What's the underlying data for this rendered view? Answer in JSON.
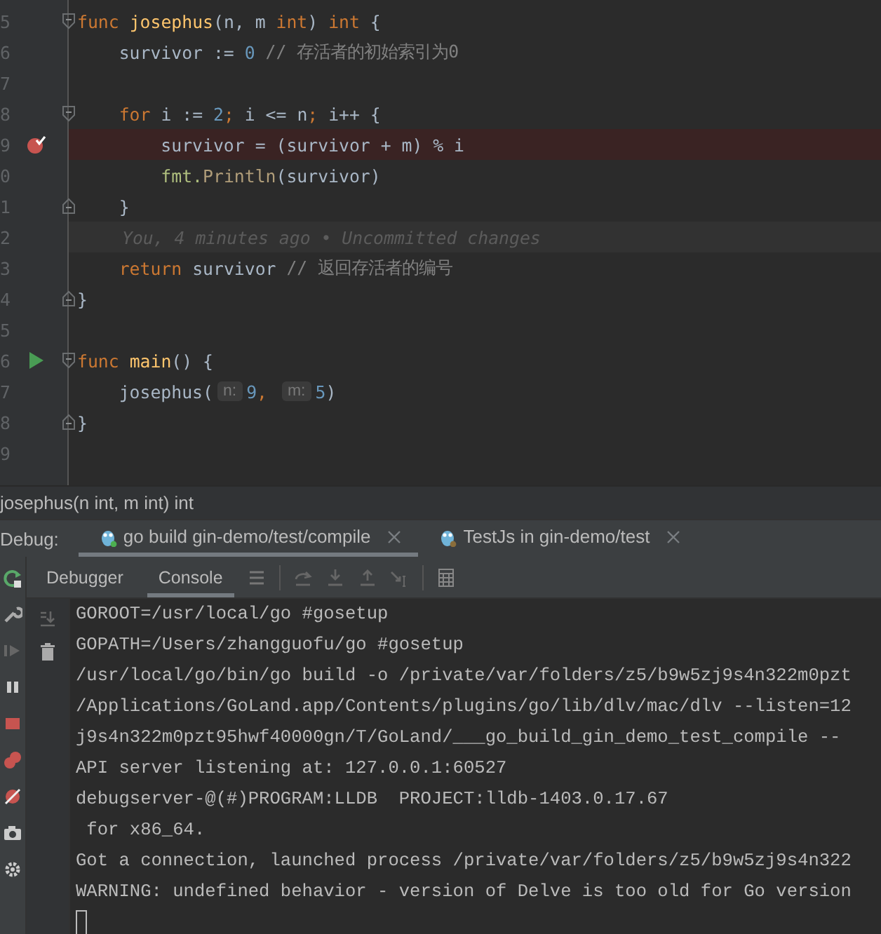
{
  "editor": {
    "lines": [
      {
        "number": "5",
        "fold_start": true,
        "tokens": [
          {
            "kind": "keyword",
            "text": "func "
          },
          {
            "kind": "function",
            "text": "josephus"
          },
          {
            "kind": "plain",
            "text": "(n, m "
          },
          {
            "kind": "keyword",
            "text": "int"
          },
          {
            "kind": "plain",
            "text": ") "
          },
          {
            "kind": "keyword",
            "text": "int"
          },
          {
            "kind": "plain",
            "text": " {"
          }
        ]
      },
      {
        "number": "6",
        "tokens": [
          {
            "kind": "plain",
            "text": "    survivor := "
          },
          {
            "kind": "number",
            "text": "0"
          },
          {
            "kind": "comment",
            "text": " // 存活者的初始索引为0"
          }
        ]
      },
      {
        "number": "7"
      },
      {
        "number": "8",
        "fold_start": true,
        "tokens": [
          {
            "kind": "keyword",
            "text": "    for "
          },
          {
            "kind": "plain",
            "text": "i := "
          },
          {
            "kind": "number",
            "text": "2"
          },
          {
            "kind": "keyword",
            "text": "; "
          },
          {
            "kind": "plain",
            "text": "i <= n"
          },
          {
            "kind": "keyword",
            "text": "; "
          },
          {
            "kind": "plain",
            "text": "i++ {"
          }
        ]
      },
      {
        "number": "9",
        "breakpoint": true,
        "tokens": [
          {
            "kind": "plain",
            "text": "        survivor = (survivor + m) % i"
          }
        ]
      },
      {
        "number": "0",
        "tokens": [
          {
            "kind": "package",
            "text": "        fmt."
          },
          {
            "kind": "call",
            "text": "Println"
          },
          {
            "kind": "plain",
            "text": "(survivor)"
          }
        ]
      },
      {
        "number": "1",
        "fold_end": true,
        "tokens": [
          {
            "kind": "plain",
            "text": "    }"
          }
        ]
      },
      {
        "number": "2",
        "current": true,
        "blame": "You, 4 minutes ago • Uncommitted changes"
      },
      {
        "number": "3",
        "tokens": [
          {
            "kind": "keyword",
            "text": "    return "
          },
          {
            "kind": "plain",
            "text": "survivor "
          },
          {
            "kind": "comment",
            "text": "// 返回存活者的编号"
          }
        ]
      },
      {
        "number": "4",
        "fold_end": true,
        "tokens": [
          {
            "kind": "plain",
            "text": "}"
          }
        ]
      },
      {
        "number": "5"
      },
      {
        "number": "6",
        "fold_start": true,
        "run": true,
        "tokens": [
          {
            "kind": "keyword",
            "text": "func "
          },
          {
            "kind": "function",
            "text": "main"
          },
          {
            "kind": "plain",
            "text": "() {"
          }
        ]
      },
      {
        "number": "7",
        "tokens": [
          {
            "kind": "plain",
            "text": "    josephus("
          },
          {
            "kind": "hint",
            "text": "n:"
          },
          {
            "kind": "number",
            "text": "9"
          },
          {
            "kind": "keyword",
            "text": ", "
          },
          {
            "kind": "hint",
            "text": "m:"
          },
          {
            "kind": "number",
            "text": "5"
          },
          {
            "kind": "plain",
            "text": ")"
          }
        ]
      },
      {
        "number": "8",
        "fold_end": true,
        "tokens": [
          {
            "kind": "plain",
            "text": "}"
          }
        ]
      },
      {
        "number": "9"
      }
    ]
  },
  "breadcrumb": "josephus(n int, m int) int",
  "debug": {
    "label": "Debug:",
    "tabs": [
      {
        "label": "go build gin-demo/test/compile",
        "selected": true
      },
      {
        "label": "TestJs in gin-demo/test",
        "selected": false
      }
    ]
  },
  "panel_tabs": [
    {
      "label": "Debugger",
      "selected": false
    },
    {
      "label": "Console",
      "selected": true
    }
  ],
  "console": {
    "lines": [
      "GOROOT=/usr/local/go #gosetup",
      "GOPATH=/Users/zhangguofu/go #gosetup",
      "/usr/local/go/bin/go build -o /private/var/folders/z5/b9w5zj9s4n322m0pzt",
      "/Applications/GoLand.app/Contents/plugins/go/lib/dlv/mac/dlv --listen=12",
      "j9s4n322m0pzt95hwf40000gn/T/GoLand/___go_build_gin_demo_test_compile --",
      "API server listening at: 127.0.0.1:60527",
      "debugserver-@(#)PROGRAM:LLDB  PROJECT:lldb-1403.0.17.67",
      " for x86_64.",
      "Got a connection, launched process /private/var/folders/z5/b9w5zj9s4n322",
      "WARNING: undefined behavior - version of Delve is too old for Go version"
    ]
  }
}
